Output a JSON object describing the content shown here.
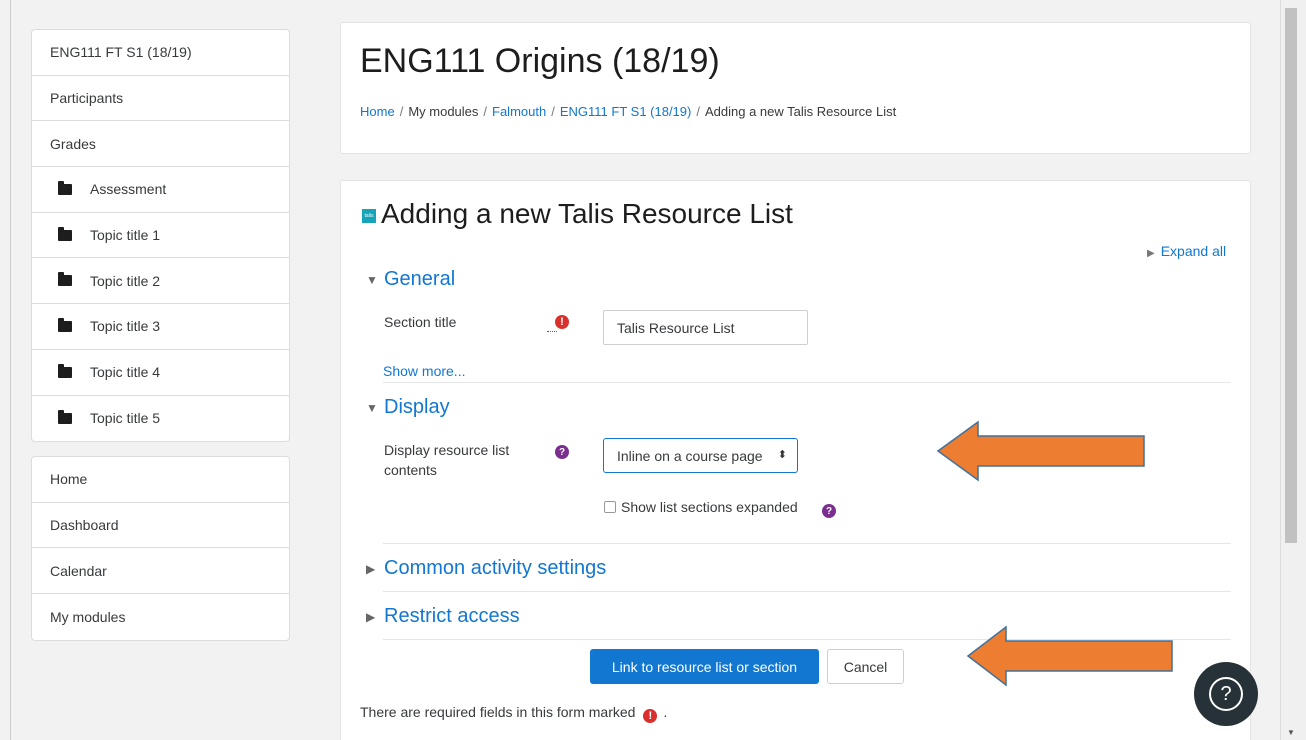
{
  "sidebar": {
    "course_nav": [
      {
        "label": "ENG111 FT S1 (18/19)",
        "folder": false
      },
      {
        "label": "Participants",
        "folder": false
      },
      {
        "label": "Grades",
        "folder": false
      },
      {
        "label": "Assessment",
        "folder": true
      },
      {
        "label": "Topic title 1",
        "folder": true
      },
      {
        "label": "Topic title 2",
        "folder": true
      },
      {
        "label": "Topic title 3",
        "folder": true
      },
      {
        "label": "Topic title 4",
        "folder": true
      },
      {
        "label": "Topic title 5",
        "folder": true
      }
    ],
    "site_nav": [
      {
        "label": "Home"
      },
      {
        "label": "Dashboard"
      },
      {
        "label": "Calendar"
      },
      {
        "label": "My modules"
      }
    ]
  },
  "header": {
    "title": "ENG111 Origins (18/19)",
    "breadcrumb": [
      "Home",
      "My modules",
      "Falmouth",
      "ENG111 FT S1 (18/19)"
    ],
    "breadcrumb_current": "Adding a new Talis Resource List"
  },
  "form": {
    "icon_text": "talis",
    "title": "Adding a new Talis Resource List",
    "expand_all": "Expand all",
    "sections": {
      "general": "General",
      "display": "Display",
      "common": "Common activity settings",
      "restrict": "Restrict access"
    },
    "section_title_label": "Section title",
    "section_title_value": "Talis Resource List",
    "show_more": "Show more...",
    "display_label": "Display resource list contents",
    "display_select_value": "Inline on a course page",
    "show_expanded_label": "Show list sections expanded",
    "submit_label": "Link to resource list or section",
    "cancel_label": "Cancel",
    "required_note": "There are required fields in this form marked",
    "required_note_end": "."
  },
  "colors": {
    "link": "#1177d1",
    "required": "#d9302d",
    "help": "#7a2f8e",
    "annotation_arrow": "#ed7d31"
  },
  "icons": {
    "required": "exclamation-circle-icon",
    "help": "question-circle-icon",
    "folder": "folder-icon",
    "floating_help": "question-icon"
  }
}
